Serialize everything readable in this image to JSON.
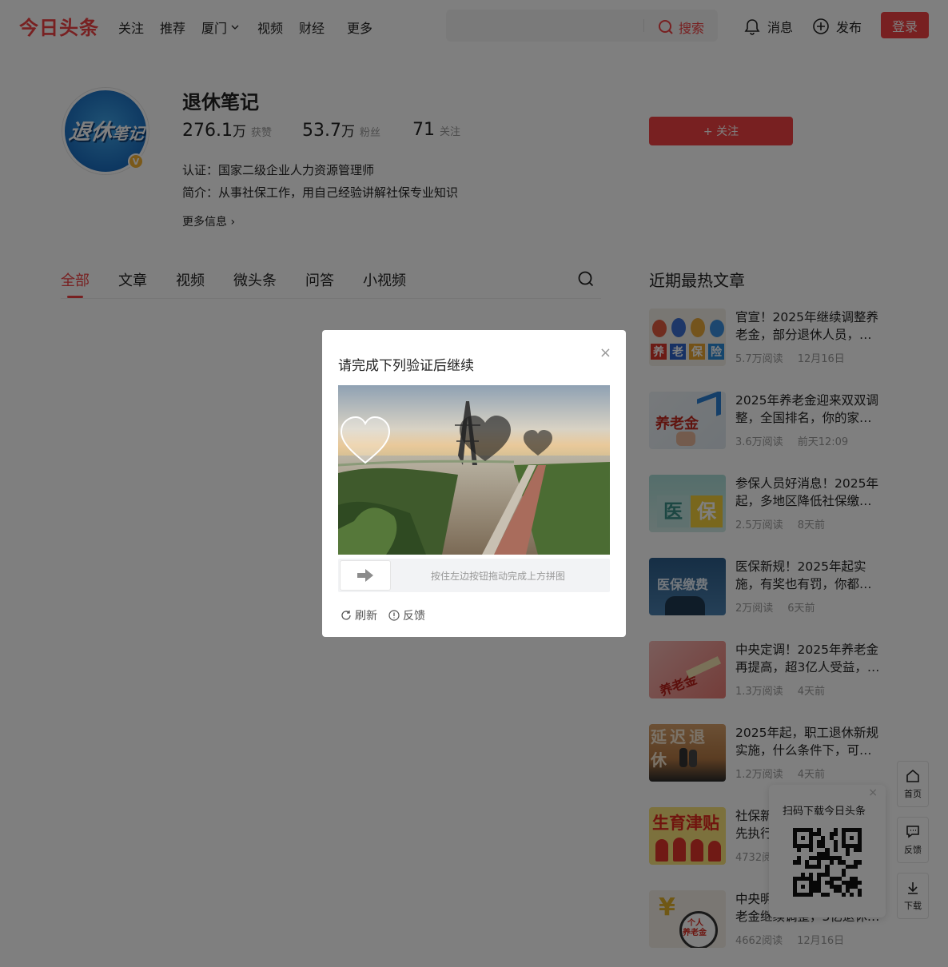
{
  "header": {
    "logo": "今日头条",
    "nav": [
      "关注",
      "推荐",
      "厦门",
      "视频",
      "财经",
      "更多"
    ],
    "search_placeholder": "",
    "search_button": "搜索",
    "messages": "消息",
    "publish": "发布",
    "login": "登录"
  },
  "profile": {
    "avatar_text_main": "退休",
    "avatar_text_small": "笔记",
    "verified_badge": "V",
    "name": "退休笔记",
    "likes": {
      "value": "276.1",
      "unit_num": "万",
      "label": "获赞"
    },
    "fans": {
      "value": "53.7",
      "unit_num": "万",
      "label": "粉丝"
    },
    "following": {
      "value": "71",
      "label": "关注"
    },
    "certification": "认证：国家二级企业人力资源管理师",
    "intro": "简介：从事社保工作，用自己经验讲解社保专业知识",
    "more_info": "更多信息",
    "follow_button": "+ 关注"
  },
  "tabs": [
    "全部",
    "文章",
    "视频",
    "微头条",
    "问答",
    "小视频"
  ],
  "recent": {
    "title": "近期最热文章",
    "articles": [
      {
        "title": "官宣！2025年继续调整养老金，部分退休人员，…",
        "reads": "5.7万阅读",
        "time": "12月16日"
      },
      {
        "title": "2025年养老金迎来双双调整，全国排名，你的家…",
        "reads": "3.6万阅读",
        "time": "前天12:09"
      },
      {
        "title": "参保人员好消息！2025年起，多地区降低社保缴…",
        "reads": "2.5万阅读",
        "time": "8天前"
      },
      {
        "title": "医保新规！2025年起实施，有奖也有罚，你都…",
        "reads": "2万阅读",
        "time": "6天前"
      },
      {
        "title": "中央定调！2025年养老金再提高，超3亿人受益，…",
        "reads": "1.3万阅读",
        "time": "4天前"
      },
      {
        "title": "2025年起，职工退休新规实施，什么条件下，可…",
        "reads": "1.2万阅读",
        "time": "4天前"
      },
      {
        "title": "社保新",
        "title2": "先执行",
        "reads": "4732阅",
        "time": ""
      },
      {
        "title": "中央明",
        "title2": "老金继续调整，3亿退休…",
        "reads": "4662阅读",
        "time": "12月16日"
      }
    ],
    "thumb_labels": {
      "a1": [
        "养",
        "老",
        "保",
        "险"
      ],
      "a2": "养老金",
      "a3": [
        "医",
        "保"
      ],
      "a4": "医保缴费",
      "a5": "养老金",
      "a6": "延迟退休",
      "a7": "生育津贴",
      "a8": [
        "个人",
        "养老金"
      ]
    }
  },
  "sidebar": {
    "home": "首页",
    "feedback": "反馈",
    "download": "下载"
  },
  "qr_popup": {
    "title": "扫码下载今日头条",
    "close": "×"
  },
  "captcha": {
    "title": "请完成下列验证后继续",
    "close": "×",
    "hint": "按住左边按钮拖动完成上方拼图",
    "refresh": "刷新",
    "feedback": "反馈"
  },
  "colors": {
    "brand": "#f04142",
    "overlay": "rgba(0,0,0,0.5)"
  }
}
